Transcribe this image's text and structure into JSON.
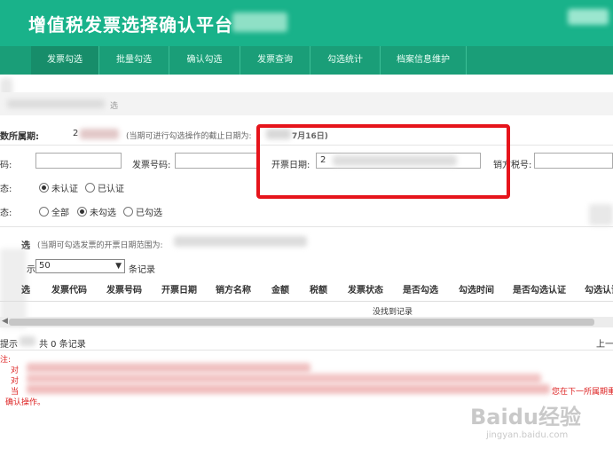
{
  "header": {
    "title": "增值税发票选择确认平台"
  },
  "nav": {
    "tabs": [
      "发票勾选",
      "批量勾选",
      "确认勾选",
      "发票查询",
      "勾选统计",
      "档案信息维护"
    ]
  },
  "breadcrumb": "选",
  "period": {
    "label": "数所属期:",
    "value": "2",
    "hint": "(当期可进行勾选操作的截止日期为:",
    "deadline": "7月16日)"
  },
  "filters": {
    "code_label": "码:",
    "number_label": "发票号码:",
    "date_label": "开票日期:",
    "date_value": "2",
    "seller_label": "销方税号:"
  },
  "status1": {
    "label": "态:",
    "options": [
      "未认证",
      "已认证"
    ],
    "selected": 0
  },
  "status2": {
    "label": "态:",
    "options": [
      "全部",
      "未勾选",
      "已勾选"
    ],
    "selected": 1
  },
  "section": {
    "title": "选",
    "hint": "(当期可勾选发票的开票日期范围为:"
  },
  "page_size": {
    "prefix": "示",
    "value": "50",
    "suffix": "条记录"
  },
  "table": {
    "headers": [
      "选",
      "发票代码",
      "发票号码",
      "开票日期",
      "销方名称",
      "金额",
      "税额",
      "发票状态",
      "是否勾选",
      "勾选时间",
      "是否勾选认证",
      "勾选认证"
    ],
    "empty": "没找到记录"
  },
  "footer": {
    "summary": "提示",
    "count": "共 0 条记录",
    "pager": "上一"
  },
  "notes": [
    "注:",
    "对",
    "对",
    "当",
    "您在下一所属期重新",
    "确认操作。"
  ],
  "watermark": {
    "logo": "Baidu经验",
    "url": "jingyan.baidu.com"
  }
}
